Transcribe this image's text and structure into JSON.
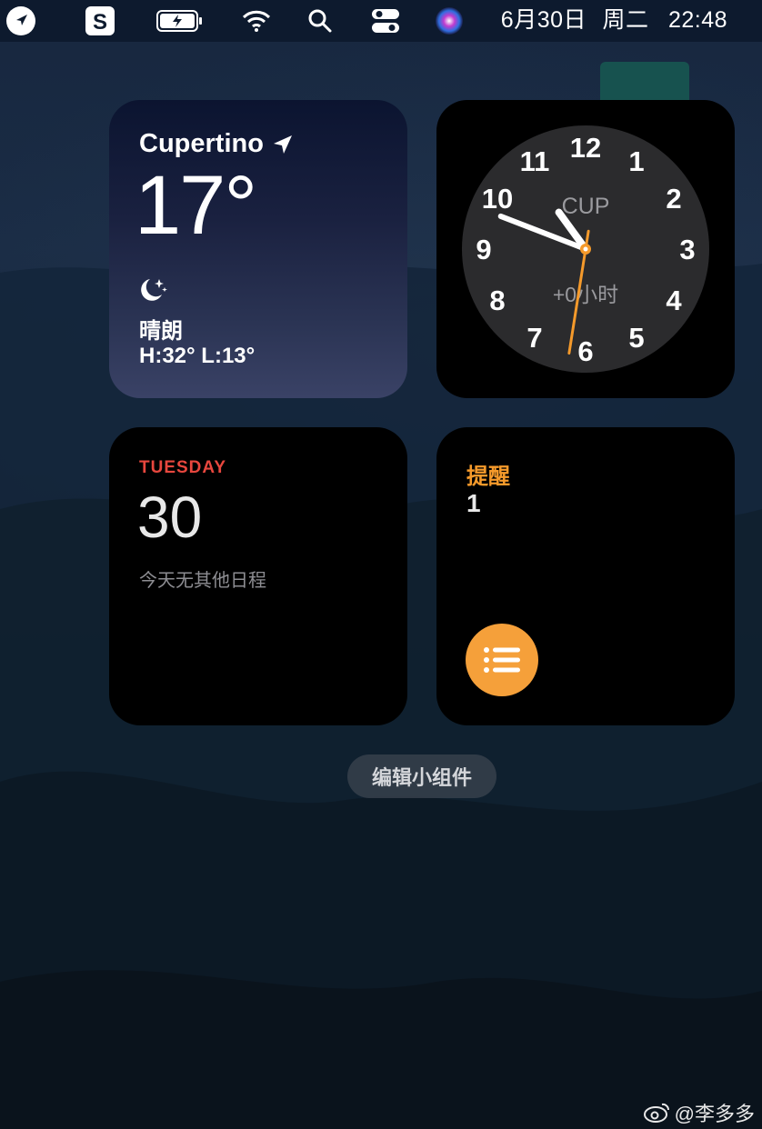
{
  "menubar": {
    "date": "6月30日",
    "weekday": "周二",
    "time": "22:48",
    "icons": [
      "location-arrow-icon",
      "sogou-input-icon",
      "battery-charging-icon",
      "wifi-icon",
      "search-icon",
      "control-center-icon",
      "siri-icon"
    ]
  },
  "weather": {
    "city": "Cupertino",
    "temperature": "17°",
    "condition": "晴朗",
    "hilo": "H:32° L:13°",
    "condition_icon": "moon-stars-icon"
  },
  "clock": {
    "city_code": "CUP",
    "offset": "+0小时",
    "numerals": [
      "12",
      "1",
      "2",
      "3",
      "4",
      "5",
      "6",
      "7",
      "8",
      "9",
      "10",
      "11"
    ],
    "hour": 10,
    "minute": 48,
    "second": 31.5,
    "hand_color": "#ffffff",
    "second_hand_color": "#f59a2b"
  },
  "calendar": {
    "weekday": "TUESDAY",
    "date": "30",
    "note": "今天无其他日程",
    "accent": "#e8473e"
  },
  "reminders": {
    "title": "提醒",
    "count": "1",
    "accent": "#f59a2b",
    "button_icon": "list-icon"
  },
  "edit_widgets_label": "编辑小组件",
  "watermark": "@李多多"
}
